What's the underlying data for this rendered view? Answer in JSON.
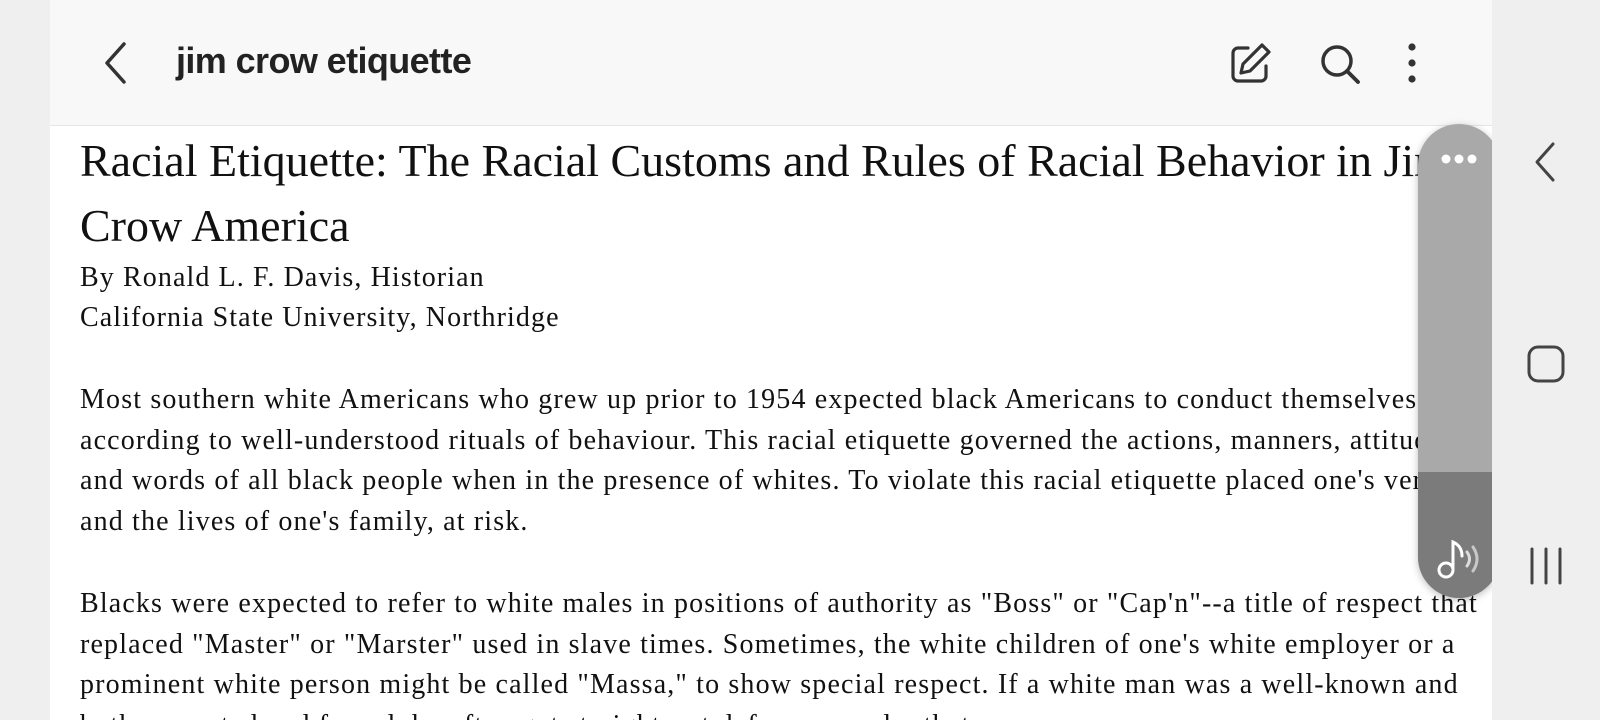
{
  "header": {
    "title": "jim crow etiquette",
    "back_icon": "chevron-left-icon",
    "actions": [
      "edit-icon",
      "search-icon",
      "more-vertical-icon"
    ]
  },
  "document": {
    "title": "Racial Etiquette: The Racial Customs and Rules of Racial Behavior in Jim Crow America",
    "byline": "By Ronald L. F. Davis, Historian",
    "affiliation": "California State University, Northridge",
    "paragraphs": [
      "Most southern white Americans who grew up prior to 1954 expected black Americans to conduct themselves according to well-understood rituals of behaviour. This racial etiquette governed the actions, manners, attitudes, and words of all black people when in the presence of whites. To violate this racial etiquette placed one's very life, and the lives of one's family, at risk.",
      "Blacks were expected to refer to white males in positions of authority as \"Boss\" or \"Cap'n\"--a title of respect that replaced \"Master\" or \"Marster\" used in slave times. Sometimes, the white children of one's white employer or a prominent white person might be called \"Massa,\" to show special respect. If a white man was a well-known and both respected and feared, he often got straight-out deference under that"
    ]
  },
  "tts_panel": {
    "more_icon": "more-horizontal-icon",
    "play_icon": "read-aloud-icon"
  },
  "system_nav": [
    "back-icon",
    "home-icon",
    "recents-icon"
  ],
  "colors": {
    "appbar_bg": "#f8f8f8",
    "page_bg": "#ffffff",
    "side_bg": "#efefef",
    "panel_bg": "#a9a9a9",
    "panel_dark": "#7b7b7b",
    "text": "#111111"
  }
}
